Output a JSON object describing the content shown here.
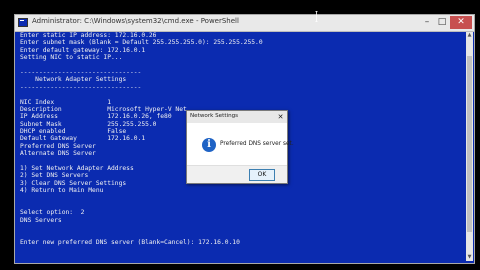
{
  "window": {
    "title": "Administrator: C:\\Windows\\system32\\cmd.exe - PowerShell",
    "controls": {
      "minimize": "–",
      "maximize": "□",
      "close": "✕"
    }
  },
  "console_lines": [
    "Enter static IP address: 172.16.0.26",
    "Enter subnet mask (Blank = Default 255.255.255.0): 255.255.255.0",
    "Enter default gateway: 172.16.0.1",
    "Setting NIC to static IP...",
    "",
    "--------------------------------",
    "    Network Adapter Settings",
    "--------------------------------",
    "",
    "NIC Index              1",
    "Description            Microsoft Hyper-V Net",
    "IP Address             172.16.0.26, fe80",
    "Subnet Mask            255.255.255.0",
    "DHCP enabled           False",
    "Default Gateway        172.16.0.1",
    "Preferred DNS Server",
    "Alternate DNS Server",
    "",
    "1) Set Network Adapter Address",
    "2) Set DNS Servers",
    "3) Clear DNS Server Settings",
    "4) Return to Main Menu",
    "",
    "",
    "Select option:  2",
    "DNS Servers",
    "",
    "",
    "Enter new preferred DNS server (Blank=Cancel): 172.16.0.10"
  ],
  "dialog": {
    "title": "Network Settings",
    "close": "✕",
    "message": "Preferred DNS server set.",
    "ok_label": "OK",
    "icon": "info-icon"
  },
  "colors": {
    "console_background": "#0b2bb0",
    "console_text": "#f2f2f2",
    "screen_background": "#000000"
  }
}
